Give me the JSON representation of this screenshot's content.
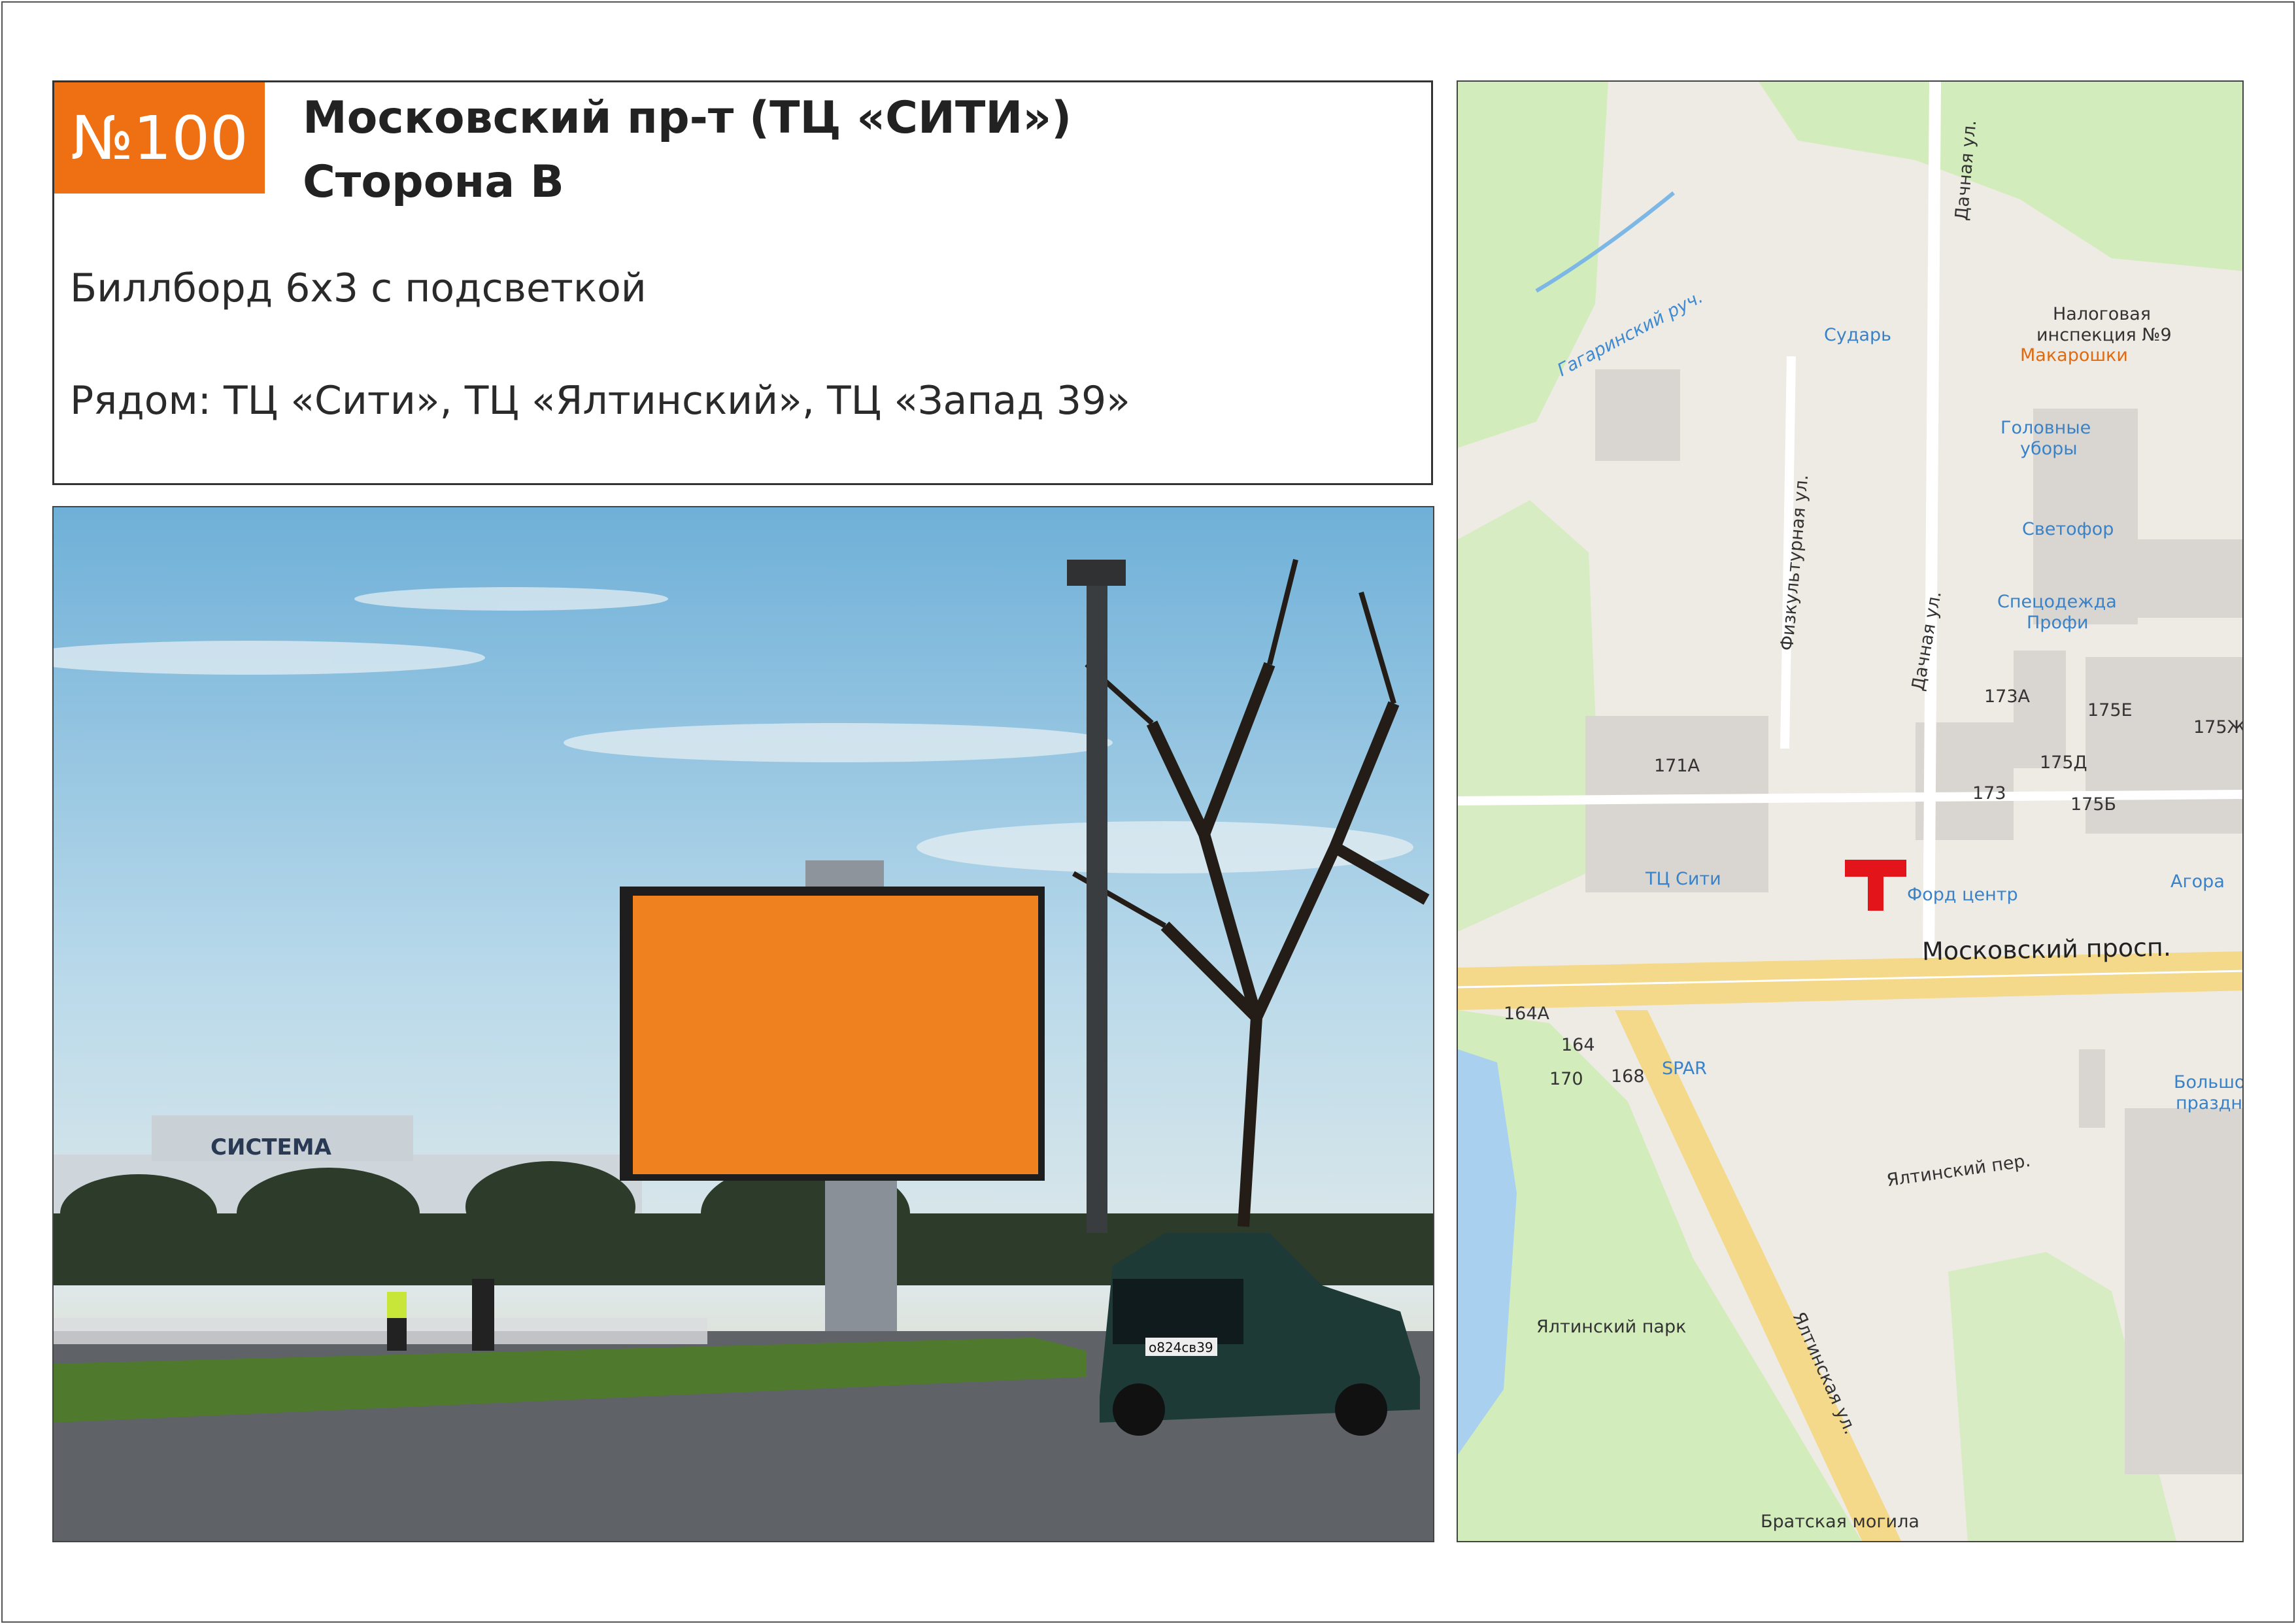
{
  "header": {
    "number": "№100",
    "title_line1": "Московский пр-т (ТЦ «СИТИ»)",
    "title_line2": "Сторона В",
    "format": "Биллборд 6х3 с подсветкой",
    "nearby": "Рядом: ТЦ «Сити», ТЦ «Ялтинский», ТЦ «Запад 39»"
  },
  "photo": {
    "building_sign": "СИСТЕМА",
    "plate": "о824св39"
  },
  "map": {
    "streets": {
      "moskovsky": "Московский просп.",
      "dachnaya_top": "Дачная ул.",
      "dachnaya_mid": "Дачная ул.",
      "fizkult": "Физкультурная ул.",
      "yaltinskaya": "Ялтинская ул.",
      "yaltinsky_per": "Ялтинский пер.",
      "gagarinsky": "Гагаринский руч."
    },
    "pois": {
      "sudar": "Сударь",
      "nalog1": "Налоговая",
      "nalog2": "инспекция №9",
      "makaroshki": "Макарошки",
      "golovnye1": "Головные",
      "golovnye2": "уборы",
      "svetofor": "Светофор",
      "specodezhda1": "Спецодежда",
      "specodezhda2": "Профи",
      "tc_siti": "ТЦ Сити",
      "ford": "Форд центр",
      "agora": "Агора",
      "spar": "SPAR",
      "yalta_park": "Ялтинский парк",
      "bratskaya": "Братская могила",
      "bolshoi1": "Большой",
      "bolshoi2": "праздни"
    },
    "labels": {
      "b171a": "171А",
      "b173": "173",
      "b173a": "173А",
      "b175e": "175Е",
      "b175zh": "175Ж",
      "b175d": "175Д",
      "b175b": "175Б",
      "b164a": "164А",
      "b164": "164",
      "b170": "170",
      "b168": "168"
    }
  }
}
